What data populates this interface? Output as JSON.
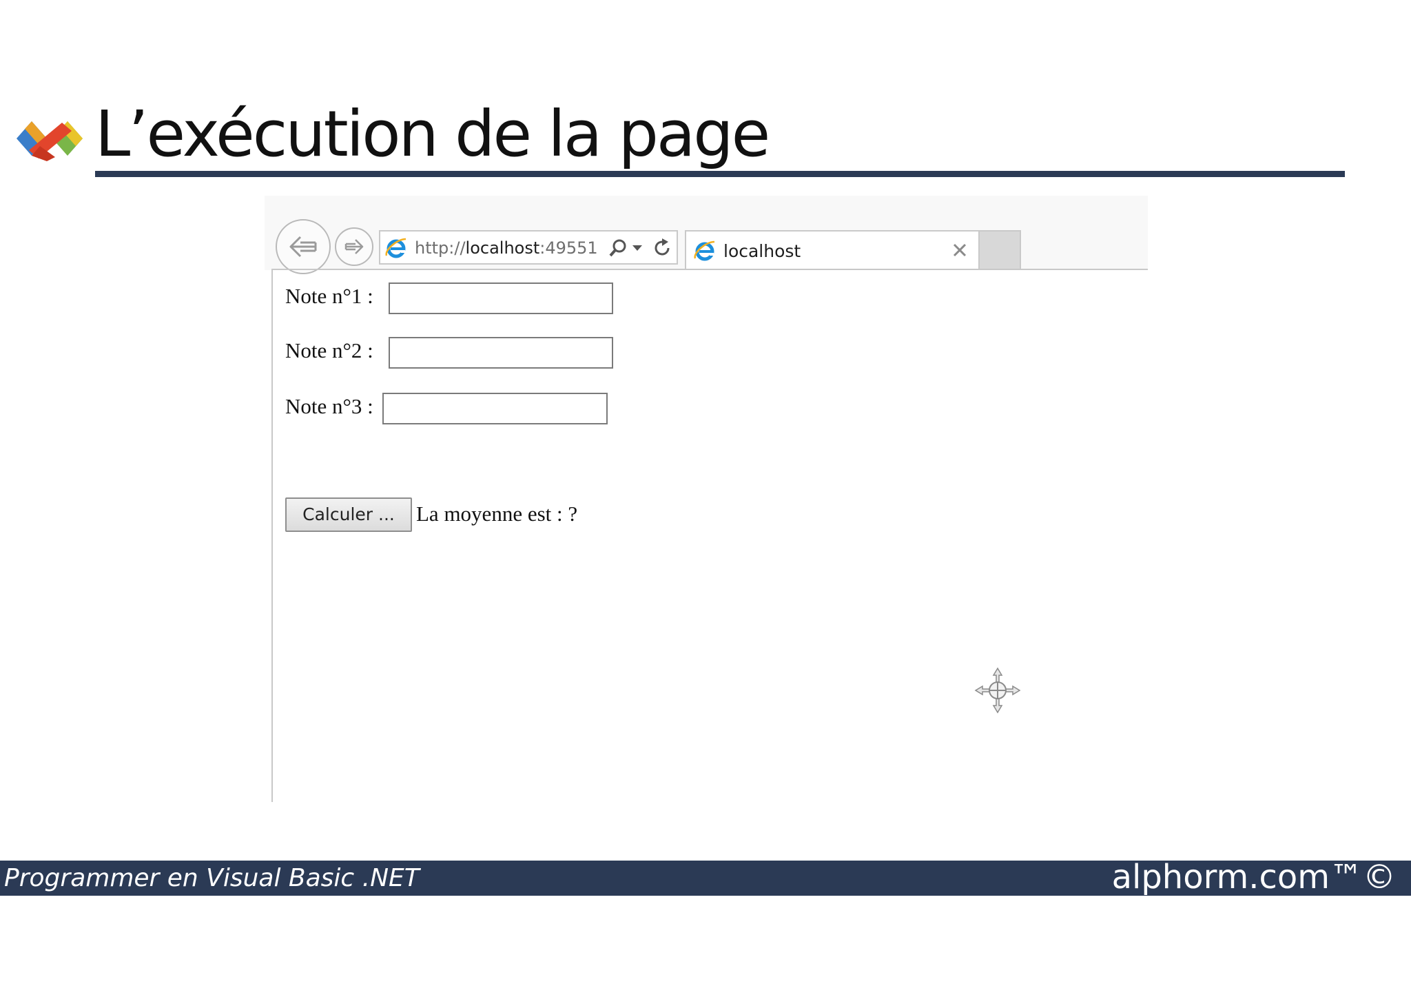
{
  "slide": {
    "title": "L’exécution de la page"
  },
  "browser": {
    "address_url_prefix": "http://",
    "address_url_host": "localhost",
    "address_url_rest": ":49551/\\",
    "tab_title": "localhost",
    "icons": [
      "back-arrow-icon",
      "forward-arrow-icon",
      "ie-icon",
      "search-icon",
      "dropdown-icon",
      "refresh-icon",
      "close-icon"
    ]
  },
  "form": {
    "note1_label": "Note n°1 :",
    "note1_value": "",
    "note2_label": "Note n°2 :",
    "note2_value": "",
    "note3_label": "Note n°3 :",
    "note3_value": "",
    "calc_button": "Calculer ...",
    "result_text": "La moyenne est : ?"
  },
  "footer": {
    "course": "Programmer en Visual Basic .NET",
    "brand": "alphorm.com™©"
  },
  "colors": {
    "accent": "#2b3a55",
    "input_border": "#7a7a7a"
  }
}
